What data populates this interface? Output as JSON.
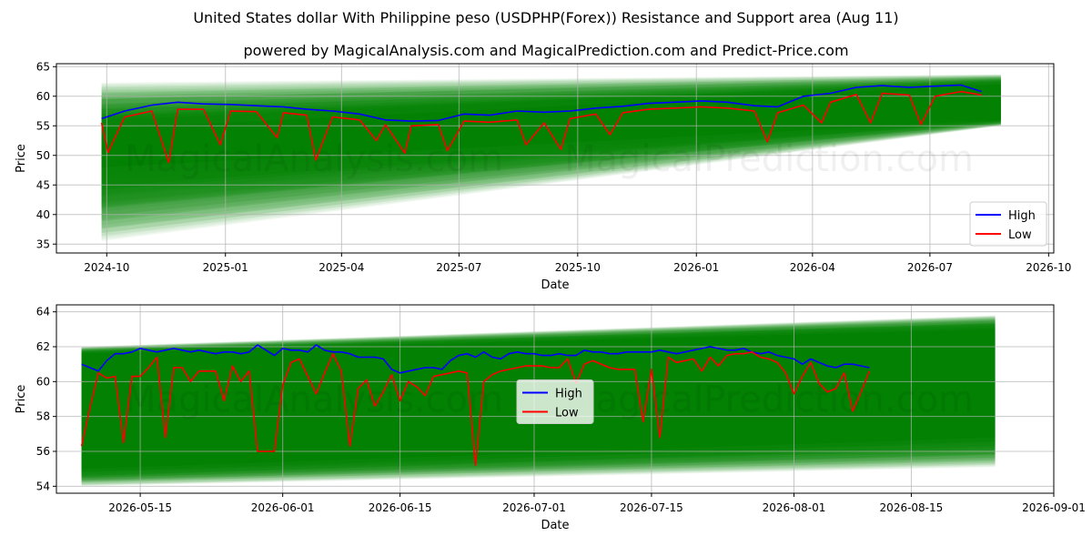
{
  "header": {
    "title": "United States dollar With Philippine peso (USDPHP(Forex)) Resistance and Support area (Aug 11)",
    "subtitle": "powered by MagicalAnalysis.com and MagicalPrediction.com and Predict-Price.com"
  },
  "watermark": {
    "text1": "MagicalAnalysis.com",
    "text2": "MagicalPrediction.com"
  },
  "colors": {
    "high": "#0000ff",
    "low": "#ff0000",
    "band": "#008000",
    "grid": "#b0b0b0"
  },
  "chart_data": [
    {
      "type": "line",
      "xlabel": "Date",
      "ylabel": "Price",
      "x_ticks": [
        "2024-10",
        "2025-01",
        "2025-04",
        "2025-07",
        "2025-10",
        "2026-01",
        "2026-04",
        "2026-07",
        "2026-10"
      ],
      "y_ticks": [
        35,
        40,
        45,
        50,
        55,
        60,
        65
      ],
      "ylim": [
        33.5,
        65.5
      ],
      "xlim": [
        "2024-08-23",
        "2026-10-05"
      ],
      "legend": {
        "position": "lower-right",
        "entries": [
          "High",
          "Low"
        ]
      },
      "grid": true,
      "band": {
        "x": [
          "2024-09-27",
          "2026-08-25"
        ],
        "upper": [
          62.3,
          63.7
        ],
        "lower": [
          35.5,
          55.0
        ],
        "core_upper": [
          54.5,
          62.0
        ],
        "core_lower": [
          48.0,
          56.0
        ]
      },
      "series": [
        {
          "name": "High",
          "x": [
            "2024-09-27",
            "2024-10-15",
            "2024-11-05",
            "2024-11-25",
            "2024-12-15",
            "2025-01-05",
            "2025-01-25",
            "2025-02-15",
            "2025-03-05",
            "2025-03-25",
            "2025-04-15",
            "2025-05-05",
            "2025-05-25",
            "2025-06-15",
            "2025-07-05",
            "2025-07-25",
            "2025-08-15",
            "2025-09-05",
            "2025-09-25",
            "2025-10-15",
            "2025-11-05",
            "2025-11-25",
            "2025-12-15",
            "2026-01-05",
            "2026-01-25",
            "2026-02-15",
            "2026-03-05",
            "2026-03-25",
            "2026-04-15",
            "2026-05-05",
            "2026-05-25",
            "2026-06-15",
            "2026-07-05",
            "2026-07-25",
            "2026-08-10"
          ],
          "values": [
            56.2,
            57.5,
            58.5,
            59.0,
            58.7,
            58.6,
            58.4,
            58.2,
            57.8,
            57.5,
            57.0,
            56.0,
            55.8,
            55.9,
            57.0,
            56.8,
            57.5,
            57.3,
            57.5,
            58.0,
            58.3,
            58.8,
            59.0,
            59.2,
            59.0,
            58.4,
            58.2,
            60.0,
            60.5,
            61.5,
            61.8,
            61.5,
            61.7,
            61.9,
            60.8
          ]
        },
        {
          "name": "Low",
          "x": [
            "2024-09-27",
            "2024-10-15",
            "2024-11-05",
            "2024-11-25",
            "2024-12-15",
            "2025-01-05",
            "2025-01-25",
            "2025-02-15",
            "2025-03-05",
            "2025-03-25",
            "2025-04-15",
            "2025-05-05",
            "2025-05-25",
            "2025-06-15",
            "2025-07-05",
            "2025-07-25",
            "2025-08-15",
            "2025-09-05",
            "2025-09-25",
            "2025-10-15",
            "2025-11-05",
            "2025-11-25",
            "2025-12-15",
            "2026-01-05",
            "2026-01-25",
            "2026-02-15",
            "2026-03-05",
            "2026-03-25",
            "2026-04-15",
            "2026-05-05",
            "2026-05-25",
            "2026-06-15",
            "2026-07-05",
            "2026-07-25",
            "2026-08-10"
          ],
          "values": [
            55.5,
            56.5,
            57.5,
            57.8,
            57.8,
            57.5,
            57.4,
            57.2,
            56.8,
            56.5,
            56.0,
            55.2,
            55.0,
            55.2,
            55.8,
            55.6,
            56.0,
            55.5,
            56.2,
            57.0,
            57.2,
            57.8,
            58.0,
            58.2,
            58.0,
            57.5,
            57.2,
            58.5,
            59.0,
            60.3,
            60.5,
            60.2,
            60.0,
            60.8,
            60.2
          ]
        }
      ],
      "dip_events": {
        "x": [
          "2024-10-02",
          "2024-11-18",
          "2024-12-28",
          "2025-02-10",
          "2025-03-12",
          "2025-04-28",
          "2025-05-20",
          "2025-06-22",
          "2025-08-22",
          "2025-09-18",
          "2025-10-26",
          "2026-02-25",
          "2026-04-08",
          "2026-05-16",
          "2026-06-24"
        ],
        "values": [
          50.5,
          48.8,
          51.8,
          53.0,
          49.2,
          52.5,
          50.4,
          50.8,
          51.8,
          51.0,
          53.5,
          52.3,
          55.5,
          55.5,
          55.2
        ]
      }
    },
    {
      "type": "line",
      "xlabel": "Date",
      "ylabel": "Price",
      "x_ticks": [
        "2026-05-15",
        "2026-06-01",
        "2026-06-15",
        "2026-07-01",
        "2026-07-15",
        "2026-08-01",
        "2026-08-15",
        "2026-09-01"
      ],
      "y_ticks": [
        54,
        56,
        58,
        60,
        62,
        64
      ],
      "ylim": [
        53.6,
        64.4
      ],
      "xlim": [
        "2026-05-05",
        "2026-09-01"
      ],
      "legend": {
        "position": "center",
        "entries": [
          "High",
          "Low"
        ]
      },
      "grid": true,
      "band": {
        "x": [
          "2026-05-08",
          "2026-08-25"
        ],
        "upper": [
          62.0,
          63.8
        ],
        "lower": [
          54.0,
          55.1
        ],
        "core_upper": [
          61.6,
          63.0
        ],
        "core_lower": [
          55.0,
          56.8
        ]
      },
      "series": [
        {
          "name": "High",
          "x": [
            "2026-05-08",
            "2026-05-09",
            "2026-05-10",
            "2026-05-11",
            "2026-05-12",
            "2026-05-13",
            "2026-05-14",
            "2026-05-15",
            "2026-05-16",
            "2026-05-17",
            "2026-05-18",
            "2026-05-19",
            "2026-05-20",
            "2026-05-21",
            "2026-05-22",
            "2026-05-23",
            "2026-05-24",
            "2026-05-25",
            "2026-05-26",
            "2026-05-27",
            "2026-05-28",
            "2026-05-29",
            "2026-05-30",
            "2026-05-31",
            "2026-06-01",
            "2026-06-02",
            "2026-06-03",
            "2026-06-04",
            "2026-06-05",
            "2026-06-06",
            "2026-06-07",
            "2026-06-08",
            "2026-06-09",
            "2026-06-10",
            "2026-06-11",
            "2026-06-12",
            "2026-06-13",
            "2026-06-14",
            "2026-06-15",
            "2026-06-16",
            "2026-06-17",
            "2026-06-18",
            "2026-06-19",
            "2026-06-20",
            "2026-06-21",
            "2026-06-22",
            "2026-06-23",
            "2026-06-24",
            "2026-06-25",
            "2026-06-26",
            "2026-06-27",
            "2026-06-28",
            "2026-06-29",
            "2026-06-30",
            "2026-07-01",
            "2026-07-02",
            "2026-07-03",
            "2026-07-04",
            "2026-07-05",
            "2026-07-06",
            "2026-07-07",
            "2026-07-08",
            "2026-07-09",
            "2026-07-10",
            "2026-07-11",
            "2026-07-12",
            "2026-07-13",
            "2026-07-14",
            "2026-07-15",
            "2026-07-16",
            "2026-07-17",
            "2026-07-18",
            "2026-07-19",
            "2026-07-20",
            "2026-07-21",
            "2026-07-22",
            "2026-07-23",
            "2026-07-24",
            "2026-07-25",
            "2026-07-26",
            "2026-07-27",
            "2026-07-28",
            "2026-07-29",
            "2026-07-30",
            "2026-07-31",
            "2026-08-01",
            "2026-08-02",
            "2026-08-03",
            "2026-08-04",
            "2026-08-05",
            "2026-08-06",
            "2026-08-07",
            "2026-08-08",
            "2026-08-09",
            "2026-08-10"
          ],
          "values": [
            61.0,
            60.8,
            60.6,
            61.2,
            61.6,
            61.6,
            61.7,
            61.9,
            61.8,
            61.7,
            61.8,
            61.9,
            61.8,
            61.7,
            61.8,
            61.7,
            61.6,
            61.7,
            61.7,
            61.6,
            61.7,
            62.1,
            61.8,
            61.5,
            61.9,
            61.8,
            61.8,
            61.7,
            62.1,
            61.8,
            61.7,
            61.7,
            61.6,
            61.4,
            61.4,
            61.4,
            61.3,
            60.7,
            60.5,
            60.6,
            60.7,
            60.8,
            60.8,
            60.7,
            61.2,
            61.5,
            61.6,
            61.4,
            61.7,
            61.4,
            61.3,
            61.6,
            61.7,
            61.6,
            61.6,
            61.5,
            61.5,
            61.6,
            61.5,
            61.5,
            61.8,
            61.7,
            61.7,
            61.6,
            61.6,
            61.7,
            61.7,
            61.7,
            61.7,
            61.8,
            61.7,
            61.6,
            61.7,
            61.8,
            61.9,
            62.0,
            61.9,
            61.8,
            61.8,
            61.9,
            61.7,
            61.6,
            61.7,
            61.5,
            61.4,
            61.3,
            61.0,
            61.3,
            61.1,
            60.9,
            60.8,
            61.0,
            61.0,
            60.9,
            60.8
          ]
        },
        {
          "name": "Low",
          "x": [
            "2026-05-08",
            "2026-05-09",
            "2026-05-10",
            "2026-05-11",
            "2026-05-12",
            "2026-05-13",
            "2026-05-14",
            "2026-05-15",
            "2026-05-16",
            "2026-05-17",
            "2026-05-18",
            "2026-05-19",
            "2026-05-20",
            "2026-05-21",
            "2026-05-22",
            "2026-05-23",
            "2026-05-24",
            "2026-05-25",
            "2026-05-26",
            "2026-05-27",
            "2026-05-28",
            "2026-05-29",
            "2026-05-30",
            "2026-05-31",
            "2026-06-01",
            "2026-06-02",
            "2026-06-03",
            "2026-06-04",
            "2026-06-05",
            "2026-06-06",
            "2026-06-07",
            "2026-06-08",
            "2026-06-09",
            "2026-06-10",
            "2026-06-11",
            "2026-06-12",
            "2026-06-13",
            "2026-06-14",
            "2026-06-15",
            "2026-06-16",
            "2026-06-17",
            "2026-06-18",
            "2026-06-19",
            "2026-06-20",
            "2026-06-21",
            "2026-06-22",
            "2026-06-23",
            "2026-06-24",
            "2026-06-25",
            "2026-06-26",
            "2026-06-27",
            "2026-06-28",
            "2026-06-29",
            "2026-06-30",
            "2026-07-01",
            "2026-07-02",
            "2026-07-03",
            "2026-07-04",
            "2026-07-05",
            "2026-07-06",
            "2026-07-07",
            "2026-07-08",
            "2026-07-09",
            "2026-07-10",
            "2026-07-11",
            "2026-07-12",
            "2026-07-13",
            "2026-07-14",
            "2026-07-15",
            "2026-07-16",
            "2026-07-17",
            "2026-07-18",
            "2026-07-19",
            "2026-07-20",
            "2026-07-21",
            "2026-07-22",
            "2026-07-23",
            "2026-07-24",
            "2026-07-25",
            "2026-07-26",
            "2026-07-27",
            "2026-07-28",
            "2026-07-29",
            "2026-07-30",
            "2026-07-31",
            "2026-08-01",
            "2026-08-02",
            "2026-08-03",
            "2026-08-04",
            "2026-08-05",
            "2026-08-06",
            "2026-08-07",
            "2026-08-08",
            "2026-08-09",
            "2026-08-10"
          ],
          "values": [
            56.3,
            58.5,
            60.5,
            60.2,
            60.3,
            56.5,
            60.3,
            60.3,
            60.8,
            61.4,
            56.8,
            60.8,
            60.8,
            60.0,
            60.6,
            60.6,
            60.6,
            58.9,
            60.9,
            60.0,
            60.6,
            56.0,
            56.0,
            56.0,
            59.8,
            61.1,
            61.3,
            60.3,
            59.3,
            60.5,
            61.6,
            60.6,
            56.3,
            59.6,
            60.1,
            58.6,
            59.4,
            60.4,
            58.9,
            60.0,
            59.7,
            59.2,
            60.3,
            60.4,
            60.5,
            60.6,
            60.5,
            55.2,
            60.0,
            60.4,
            60.6,
            60.7,
            60.8,
            60.9,
            60.9,
            60.9,
            60.8,
            60.8,
            61.3,
            59.9,
            61.0,
            61.2,
            61.0,
            60.8,
            60.7,
            60.7,
            60.7,
            57.7,
            60.7,
            56.8,
            61.4,
            61.1,
            61.2,
            61.3,
            60.6,
            61.4,
            60.9,
            61.5,
            61.6,
            61.6,
            61.7,
            61.4,
            61.3,
            61.1,
            60.5,
            59.3,
            60.3,
            61.1,
            59.9,
            59.4,
            59.6,
            60.5,
            58.3,
            59.4,
            60.6
          ]
        }
      ]
    }
  ]
}
